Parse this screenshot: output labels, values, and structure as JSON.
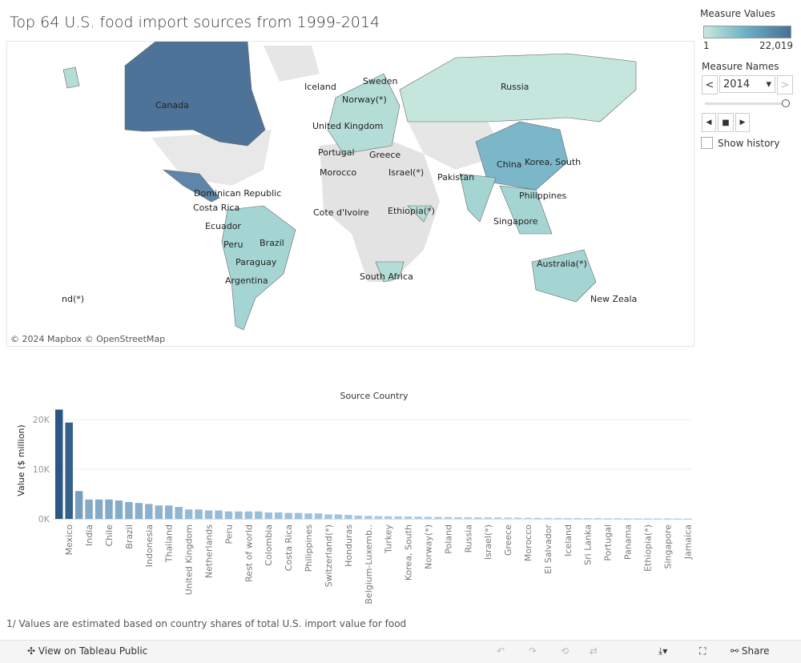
{
  "title": "Top 64 U.S. food import sources from 1999-2014",
  "map": {
    "attribution": "© 2024 Mapbox  © OpenStreetMap",
    "labels": [
      "Canada",
      "Russia",
      "Iceland",
      "Sweden",
      "Norway(*)",
      "United Kingdom",
      "Portugal",
      "Greece",
      "Morocco",
      "Israel(*)",
      "Pakistan",
      "China",
      "Korea, South",
      "Dominican Republic",
      "Costa Rica",
      "Ecuador",
      "Peru",
      "Brazil",
      "Paraguay",
      "Argentina",
      "Cote d'Ivoire",
      "Ethiopia(*)",
      "Philippines",
      "Singapore",
      "Australia(*)",
      "South Africa",
      "New Zeala",
      "nd(*)"
    ],
    "colors": {
      "high": "#4e7399",
      "mid": "#7bb7c9",
      "low": "#c5e6dc",
      "nodata": "#e3e3e3"
    }
  },
  "legend": {
    "measure_values_title": "Measure Values",
    "min": "1",
    "max": "22,019",
    "measure_names_title": "Measure Names",
    "year": "2014",
    "prev": "<",
    "next": ">",
    "show_history": "Show history"
  },
  "chart_data": {
    "type": "bar",
    "title": "Source Country",
    "ylabel": "Value ($ million)",
    "ylim": [
      0,
      23000
    ],
    "yticks": [
      "0K",
      "10K",
      "20K"
    ],
    "grid": true,
    "categories": [
      "",
      "Mexico",
      "",
      "India",
      "",
      "Chile",
      "",
      "Brazil",
      "",
      "Indonesia",
      "",
      "Thailand",
      "",
      "United Kingdom",
      "",
      "Netherlands",
      "",
      "Peru",
      "",
      "Rest of world",
      "",
      "Colombia",
      "",
      "Costa Rica",
      "",
      "Philippines",
      "",
      "Switzerland(*)",
      "",
      "Honduras",
      "",
      "Belgium-Luxemb..",
      "",
      "Turkey",
      "",
      "Korea, South",
      "",
      "Norway(*)",
      "",
      "Poland",
      "",
      "Russia",
      "",
      "Israel(*)",
      "",
      "Greece",
      "",
      "Morocco",
      "",
      "El Salvador",
      "",
      "Iceland",
      "",
      "Sri Lanka",
      "",
      "Portugal",
      "",
      "Panama",
      "",
      "Ethiopia(*)",
      "",
      "Singapore",
      "",
      "Jamaica"
    ],
    "values": [
      22019,
      19400,
      5600,
      3900,
      3900,
      3900,
      3700,
      3400,
      3200,
      3000,
      2700,
      2700,
      2400,
      1900,
      1900,
      1700,
      1700,
      1500,
      1500,
      1500,
      1500,
      1300,
      1300,
      1200,
      1200,
      1100,
      1100,
      900,
      900,
      800,
      650,
      600,
      550,
      520,
      500,
      470,
      450,
      420,
      400,
      380,
      350,
      330,
      310,
      300,
      290,
      270,
      250,
      230,
      210,
      200,
      190,
      180,
      170,
      160,
      150,
      140,
      130,
      120,
      110,
      100,
      95,
      90,
      85,
      80
    ],
    "color_range": [
      "#2a5783",
      "#b5d8ee"
    ]
  },
  "footnote": "1/ Values are estimated based on country shares of total U.S. import  value for food",
  "toolbar": {
    "view": "View on Tableau Public",
    "share": "Share"
  }
}
